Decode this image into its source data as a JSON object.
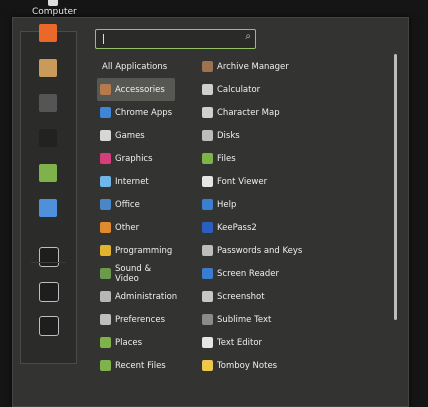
{
  "desktop": {
    "icon_label": "Computer"
  },
  "search": {
    "placeholder": "",
    "value": "",
    "icon": "search-icon"
  },
  "favorites": [
    {
      "name": "firefox-icon",
      "color": "#e8692a"
    },
    {
      "name": "package-icon",
      "color": "#c99a5a"
    },
    {
      "name": "settings-icon",
      "color": "#555"
    },
    {
      "name": "terminal-icon",
      "color": "#222"
    },
    {
      "name": "folder-icon",
      "color": "#7fb24a"
    },
    {
      "name": "chrome-icon",
      "color": "#4f8fdc"
    },
    {
      "name": "lock-screen-icon",
      "color": "#222"
    },
    {
      "name": "logout-icon",
      "color": "#222"
    },
    {
      "name": "shutdown-icon",
      "color": "#222"
    }
  ],
  "categories": [
    {
      "label": "All Applications",
      "icon": "none",
      "color": "",
      "selected": false
    },
    {
      "label": "Accessories",
      "icon": "accessories-icon",
      "color": "#b77a4c",
      "selected": true
    },
    {
      "label": "Chrome Apps",
      "icon": "chrome-icon",
      "color": "#3d86d8",
      "selected": false
    },
    {
      "label": "Games",
      "icon": "games-icon",
      "color": "#d7d7d7",
      "selected": false
    },
    {
      "label": "Graphics",
      "icon": "graphics-icon",
      "color": "#d53d7b",
      "selected": false
    },
    {
      "label": "Internet",
      "icon": "internet-icon",
      "color": "#6fb6ea",
      "selected": false
    },
    {
      "label": "Office",
      "icon": "office-icon",
      "color": "#4b86c6",
      "selected": false
    },
    {
      "label": "Other",
      "icon": "other-icon",
      "color": "#e08a2e",
      "selected": false
    },
    {
      "label": "Programming",
      "icon": "programming-icon",
      "color": "#e2b32d",
      "selected": false
    },
    {
      "label": "Sound & Video",
      "icon": "sound-video-icon",
      "color": "#6b9a4c",
      "selected": false
    },
    {
      "label": "Administration",
      "icon": "administration-icon",
      "color": "#b7b7b7",
      "selected": false
    },
    {
      "label": "Preferences",
      "icon": "preferences-icon",
      "color": "#bfbfbf",
      "selected": false
    },
    {
      "label": "Places",
      "icon": "folder-icon",
      "color": "#7fb24a",
      "selected": false
    },
    {
      "label": "Recent Files",
      "icon": "folder-icon",
      "color": "#7fb24a",
      "selected": false
    }
  ],
  "apps": [
    {
      "label": "Archive Manager",
      "icon": "archive-icon",
      "color": "#a0714f"
    },
    {
      "label": "Calculator",
      "icon": "calculator-icon",
      "color": "#cfcfcf"
    },
    {
      "label": "Character Map",
      "icon": "character-map-icon",
      "color": "#d0d0d0"
    },
    {
      "label": "Disks",
      "icon": "disks-icon",
      "color": "#bdbdbd"
    },
    {
      "label": "Files",
      "icon": "folder-icon",
      "color": "#7fb24a"
    },
    {
      "label": "Font Viewer",
      "icon": "font-icon",
      "color": "#e6e6e6"
    },
    {
      "label": "Help",
      "icon": "help-icon",
      "color": "#3c7fd0"
    },
    {
      "label": "KeePass2",
      "icon": "keepass-icon",
      "color": "#2a5fc0"
    },
    {
      "label": "Passwords and Keys",
      "icon": "keys-icon",
      "color": "#bdbdbd"
    },
    {
      "label": "Screen Reader",
      "icon": "accessibility-icon",
      "color": "#3a7bd4"
    },
    {
      "label": "Screenshot",
      "icon": "screenshot-icon",
      "color": "#c7c7c7"
    },
    {
      "label": "Sublime Text",
      "icon": "sublime-icon",
      "color": "#8b8b8b"
    },
    {
      "label": "Text Editor",
      "icon": "text-editor-icon",
      "color": "#e6e6e6"
    },
    {
      "label": "Tomboy Notes",
      "icon": "notes-icon",
      "color": "#f0c64b"
    }
  ]
}
